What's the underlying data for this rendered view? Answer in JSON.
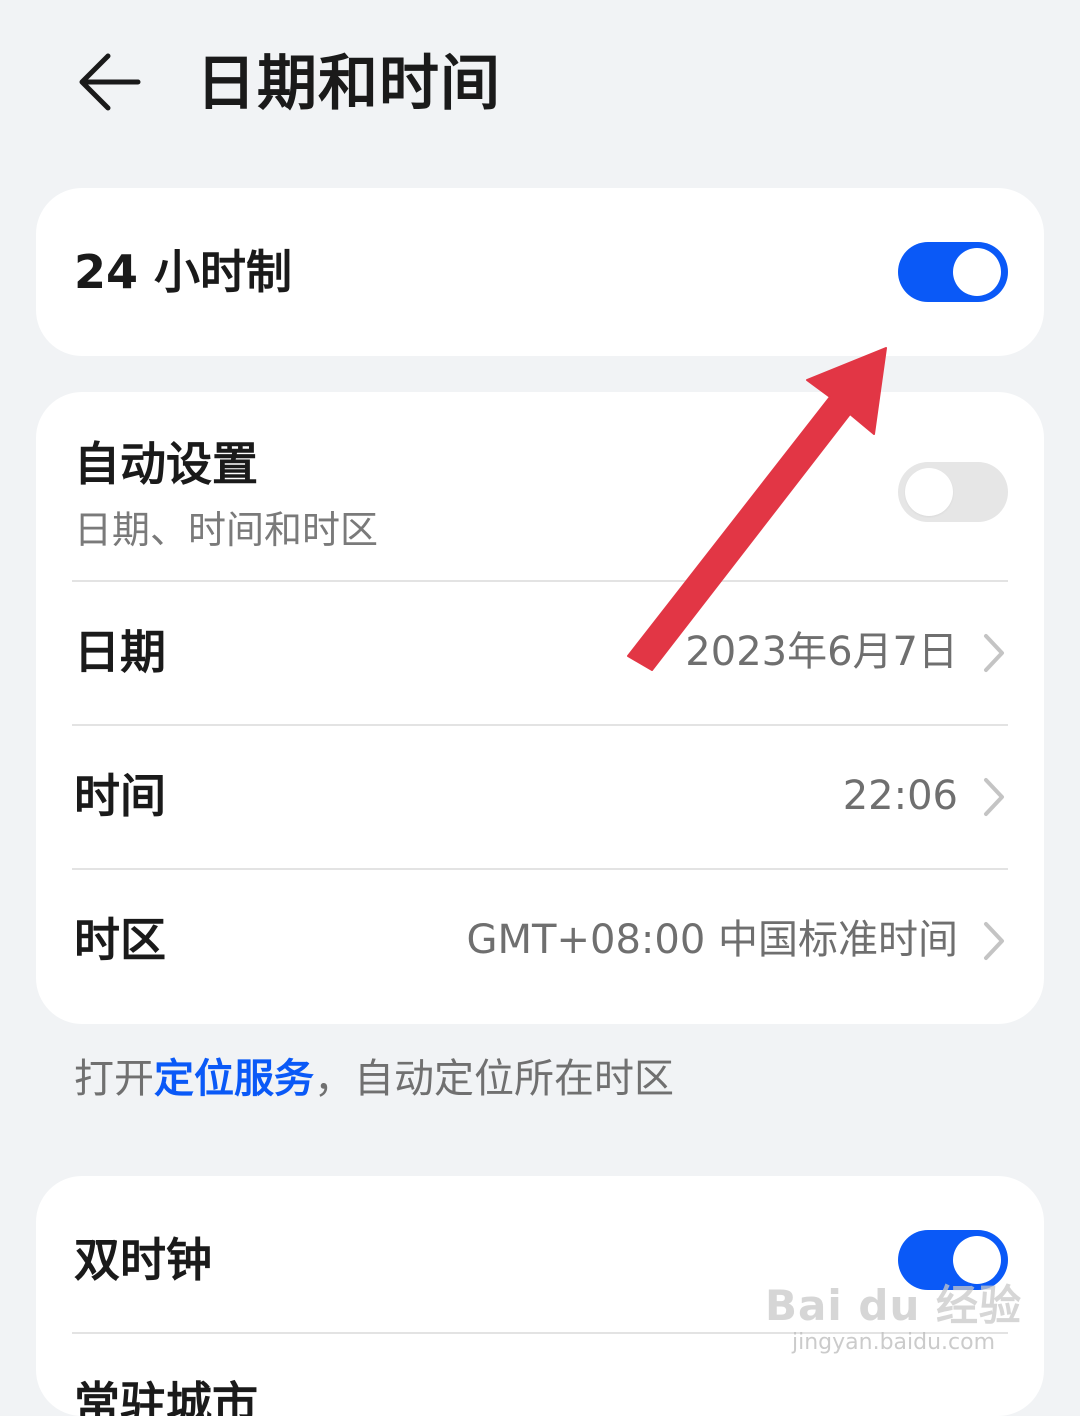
{
  "header": {
    "title": "日期和时间",
    "back_icon": "back-arrow-icon"
  },
  "card_24h": {
    "label": "24 小时制",
    "toggle_on": true
  },
  "card_auto": {
    "auto": {
      "label": "自动设置",
      "sublabel": "日期、时间和时区",
      "toggle_on": false
    },
    "date": {
      "label": "日期",
      "value": "2023年6月7日"
    },
    "time": {
      "label": "时间",
      "value": "22:06"
    },
    "timezone": {
      "label": "时区",
      "value": "GMT+08:00 中国标准时间"
    }
  },
  "footnote": {
    "prefix": "打开",
    "link": "定位服务",
    "suffix": "，自动定位所在时区"
  },
  "card_dual": {
    "dual_clock": {
      "label": "双时钟",
      "toggle_on": true
    },
    "next_label_partial": "常驻城市"
  },
  "watermark": {
    "logo": "Bai du 经验",
    "url": "jingyan.baidu.com"
  },
  "colors": {
    "accent": "#0a59f7",
    "annotation_arrow": "#e23645",
    "background": "#f1f3f5",
    "card": "#ffffff"
  }
}
